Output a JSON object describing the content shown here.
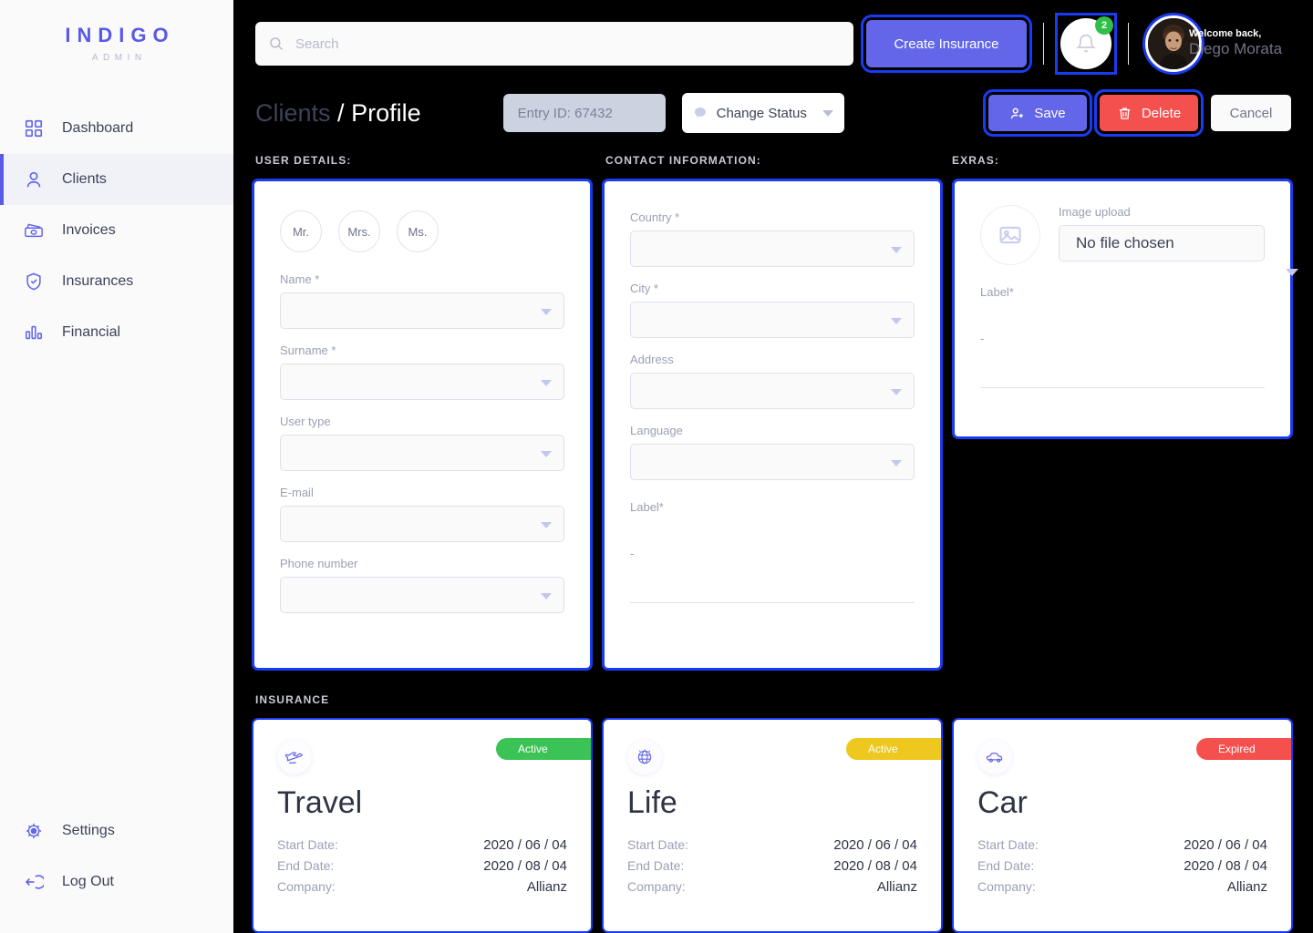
{
  "brand": {
    "title": "INDIGO",
    "subtitle": "ADMIN"
  },
  "sidebar": {
    "items": [
      {
        "label": "Dashboard",
        "icon": "grid-icon"
      },
      {
        "label": "Clients",
        "icon": "user-icon"
      },
      {
        "label": "Invoices",
        "icon": "money-icon"
      },
      {
        "label": "Insurances",
        "icon": "shield-check-icon"
      },
      {
        "label": "Financial",
        "icon": "bar-chart-icon"
      }
    ],
    "bottom": [
      {
        "label": "Settings",
        "icon": "gear-icon"
      },
      {
        "label": "Log Out",
        "icon": "logout-icon"
      }
    ]
  },
  "header": {
    "search_placeholder": "Search",
    "search_value": "",
    "create_label": "Create Insurance",
    "notification_count": "2",
    "welcome_small": "Welcome back,",
    "welcome_name": "Diego Morata"
  },
  "breadcrumb": {
    "parent": "Clients",
    "sep": "/",
    "current": "Profile"
  },
  "toolbar": {
    "entry_id": "Entry ID: 67432",
    "change_status": "Change Status",
    "save_label": "Save",
    "delete_label": "Delete",
    "cancel_label": "Cancel"
  },
  "sections": {
    "user_details": "USER DETAILS:",
    "contact_information": "CONTACT INFORMATION:",
    "extras": "EXRAS:",
    "insurance": "INSURANCE"
  },
  "user_details": {
    "salutations": [
      "Mr.",
      "Mrs.",
      "Ms."
    ],
    "fields": [
      {
        "label": "Name *",
        "value": ""
      },
      {
        "label": "Surname *",
        "value": ""
      },
      {
        "label": "User type",
        "value": ""
      },
      {
        "label": "E-mail",
        "value": ""
      },
      {
        "label": "Phone number",
        "value": ""
      }
    ]
  },
  "contact_information": {
    "fields": [
      {
        "label": "Country *",
        "value": ""
      },
      {
        "label": "City *",
        "value": ""
      },
      {
        "label": "Address",
        "value": ""
      },
      {
        "label": "Language",
        "value": ""
      }
    ],
    "label_field": {
      "label": "Label*",
      "value": "-"
    }
  },
  "extras": {
    "upload_label": "Image upload",
    "upload_value": "No file chosen",
    "label_field": {
      "label": "Label*",
      "value": "-"
    }
  },
  "insurance_cards": [
    {
      "title": "Travel",
      "icon": "plane-icon",
      "status": "Active",
      "status_color": "#3cc356",
      "rows": [
        {
          "key": "Start Date:",
          "value": "2020 / 06 / 04"
        },
        {
          "key": "End Date:",
          "value": "2020 / 08 / 04"
        },
        {
          "key": "Company:",
          "value": "Allianz"
        }
      ]
    },
    {
      "title": "Life",
      "icon": "globe-icon",
      "status": "Active",
      "status_color": "#eec81e",
      "rows": [
        {
          "key": "Start Date:",
          "value": "2020 / 06 / 04"
        },
        {
          "key": "End Date:",
          "value": "2020 / 08 / 04"
        },
        {
          "key": "Company:",
          "value": "Allianz"
        }
      ]
    },
    {
      "title": "Car",
      "icon": "car-icon",
      "status": "Expired",
      "status_color": "#f4504e",
      "rows": [
        {
          "key": "Start Date:",
          "value": "2020 / 06 / 04"
        },
        {
          "key": "End Date:",
          "value": "2020 / 08 / 04"
        },
        {
          "key": "Company:",
          "value": "Allianz"
        }
      ]
    }
  ],
  "colors": {
    "brand": "#5a5ae6",
    "accent": "#6366e8",
    "focus": "#1a3cf0",
    "danger": "#f4504e",
    "success": "#3cc356",
    "warning": "#eec81e",
    "page_bg": "#000000"
  }
}
